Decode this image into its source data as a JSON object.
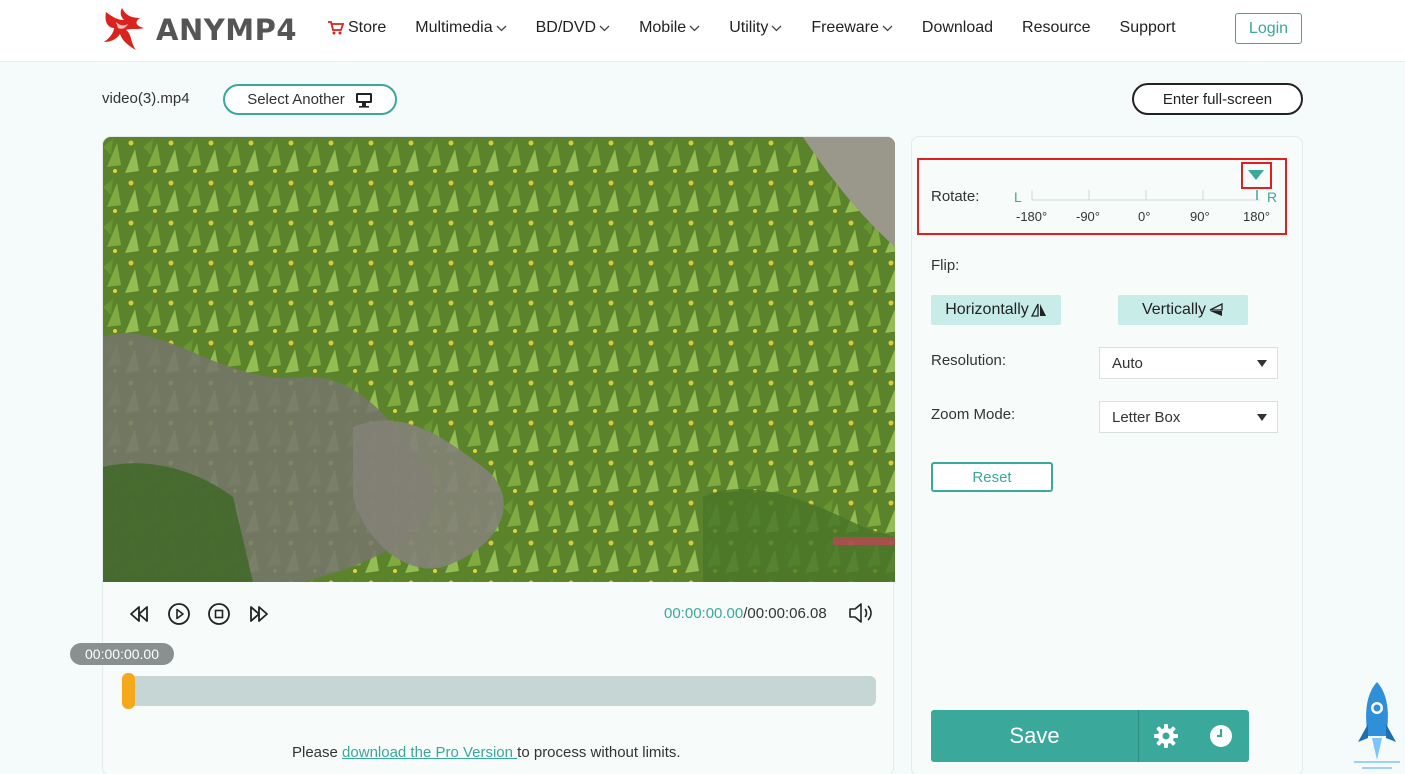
{
  "header": {
    "logo_text": "ANYMP4",
    "nav": [
      {
        "label": "Store",
        "icon": "cart-icon"
      },
      {
        "label": "Multimedia",
        "dropdown": true
      },
      {
        "label": "BD/DVD",
        "dropdown": true
      },
      {
        "label": "Mobile",
        "dropdown": true
      },
      {
        "label": "Utility",
        "dropdown": true
      },
      {
        "label": "Freeware",
        "dropdown": true
      },
      {
        "label": "Download"
      },
      {
        "label": "Resource"
      },
      {
        "label": "Support"
      }
    ],
    "login_label": "Login"
  },
  "toolbar": {
    "file_name": "video(3).mp4",
    "select_another_label": "Select Another",
    "fullscreen_label": "Enter full-screen"
  },
  "player": {
    "current_time": "00:00:00.00",
    "total_time": "/00:00:06.08",
    "bubble_time": "00:00:00.00",
    "progress": 0
  },
  "pro_note": {
    "prefix": "Please ",
    "link": "download the Pro Version ",
    "suffix": "to process without limits."
  },
  "settings": {
    "rotate_label": "Rotate:",
    "rotate_left": "L",
    "rotate_right": "R",
    "rotate_ticks": [
      "-180°",
      "-90°",
      "0°",
      "90°",
      "180°"
    ],
    "rotate_value": 180,
    "flip_label": "Flip:",
    "flip_horizontal": "Horizontally",
    "flip_vertical": "Vertically",
    "resolution_label": "Resolution:",
    "resolution_value": "Auto",
    "zoom_label": "Zoom Mode:",
    "zoom_value": "Letter Box",
    "reset_label": "Reset",
    "save_label": "Save"
  },
  "colors": {
    "accent": "#3aa89b",
    "highlight": "#e02020",
    "handle": "#f5a81c"
  }
}
